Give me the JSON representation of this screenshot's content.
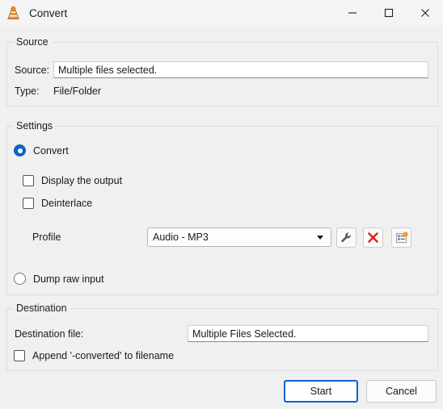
{
  "window": {
    "title": "Convert",
    "icon": "vlc-cone-icon",
    "controls": {
      "minimize": "—",
      "maximize": "□",
      "close": "✕"
    }
  },
  "source": {
    "group_title": "Source",
    "source_label": "Source:",
    "source_value": "Multiple files selected.",
    "type_label": "Type:",
    "type_value": "File/Folder"
  },
  "settings": {
    "group_title": "Settings",
    "convert_radio_label": "Convert",
    "convert_radio_selected": true,
    "display_output_label": "Display the output",
    "display_output_checked": false,
    "deinterlace_label": "Deinterlace",
    "deinterlace_checked": false,
    "profile_label": "Profile",
    "profile_value": "Audio - MP3",
    "profile_options": [
      "Audio - MP3"
    ],
    "edit_profile_icon": "wrench-icon",
    "delete_profile_icon": "red-x-icon",
    "new_profile_icon": "new-profile-icon",
    "dump_raw_label": "Dump raw input",
    "dump_raw_selected": false
  },
  "destination": {
    "group_title": "Destination",
    "file_label": "Destination file:",
    "file_value": "Multiple Files Selected.",
    "append_label": "Append '-converted' to filename",
    "append_checked": false
  },
  "actions": {
    "start_label": "Start",
    "cancel_label": "Cancel"
  },
  "colors": {
    "accent": "#0b63ce",
    "danger": "#d42020",
    "background": "#f0f0f0"
  }
}
